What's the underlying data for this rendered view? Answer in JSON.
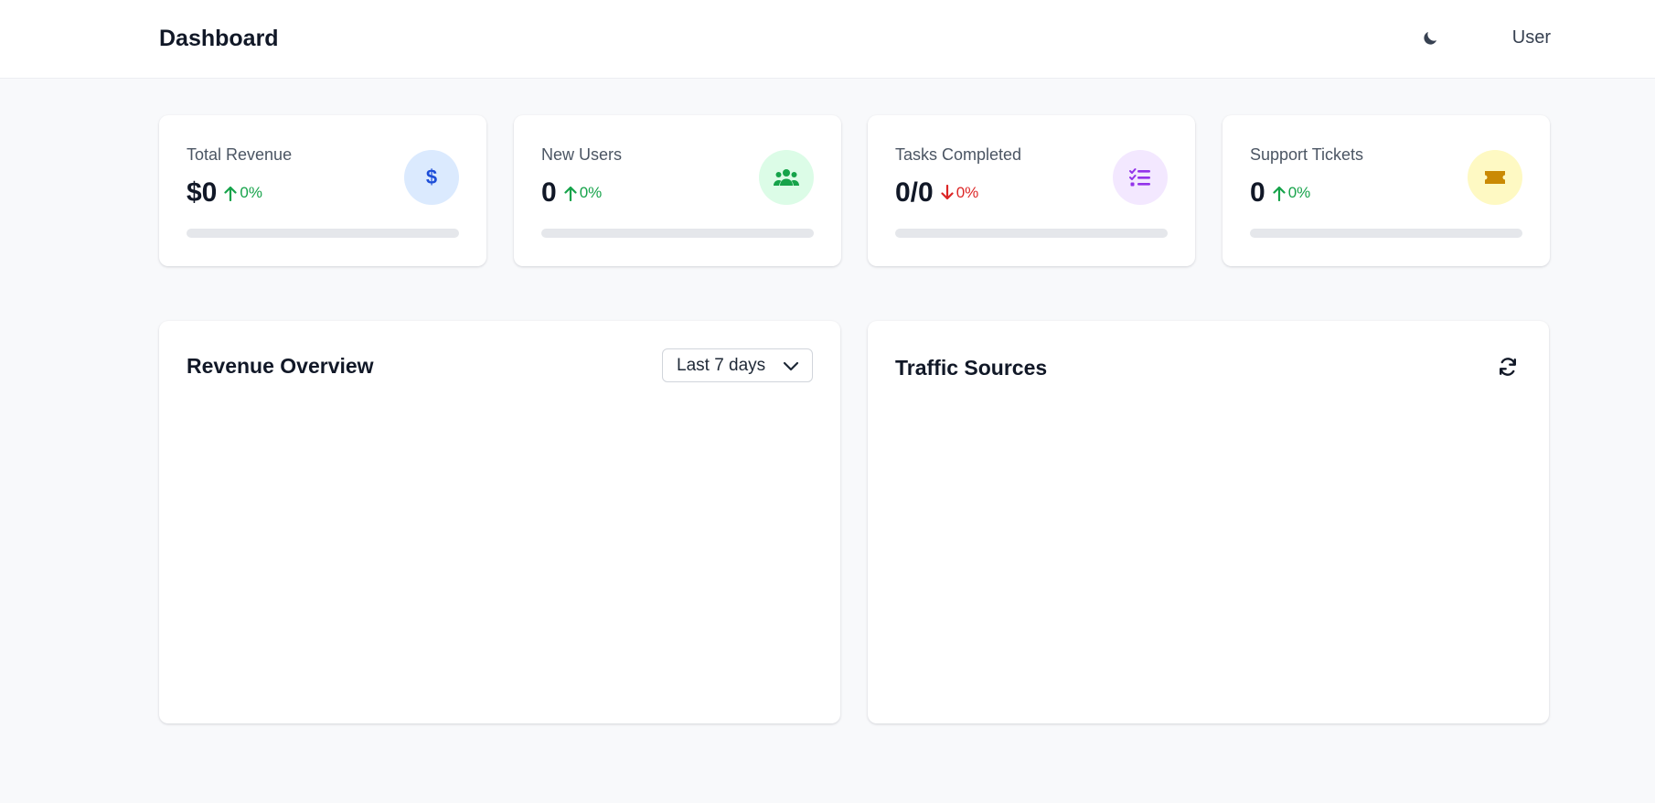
{
  "header": {
    "title": "Dashboard",
    "theme_toggle_icon": "moon-icon",
    "user_label": "User"
  },
  "stats": [
    {
      "label": "Total Revenue",
      "value": "$0",
      "change": "0%",
      "trend": "up",
      "icon": "dollar-icon",
      "icon_bg": "#dbeafe",
      "icon_color": "#1d4ed8",
      "progress": 0
    },
    {
      "label": "New Users",
      "value": "0",
      "change": "0%",
      "trend": "up",
      "icon": "users-icon",
      "icon_bg": "#dcfce7",
      "icon_color": "#16a34a",
      "progress": 0
    },
    {
      "label": "Tasks Completed",
      "value": "0/0",
      "change": "0%",
      "trend": "down",
      "icon": "task-list-icon",
      "icon_bg": "#f3e8ff",
      "icon_color": "#9333ea",
      "progress": 0
    },
    {
      "label": "Support Tickets",
      "value": "0",
      "change": "0%",
      "trend": "up",
      "icon": "ticket-icon",
      "icon_bg": "#fef9c3",
      "icon_color": "#ca8a04",
      "progress": 0
    }
  ],
  "revenue_panel": {
    "title": "Revenue Overview",
    "range_selected": "Last 7 days"
  },
  "traffic_panel": {
    "title": "Traffic Sources",
    "refresh_icon": "refresh-icon"
  },
  "colors": {
    "accent": "#3b82f6",
    "positive": "#16a34a",
    "negative": "#dc2626",
    "background": "#f8f9fb"
  }
}
